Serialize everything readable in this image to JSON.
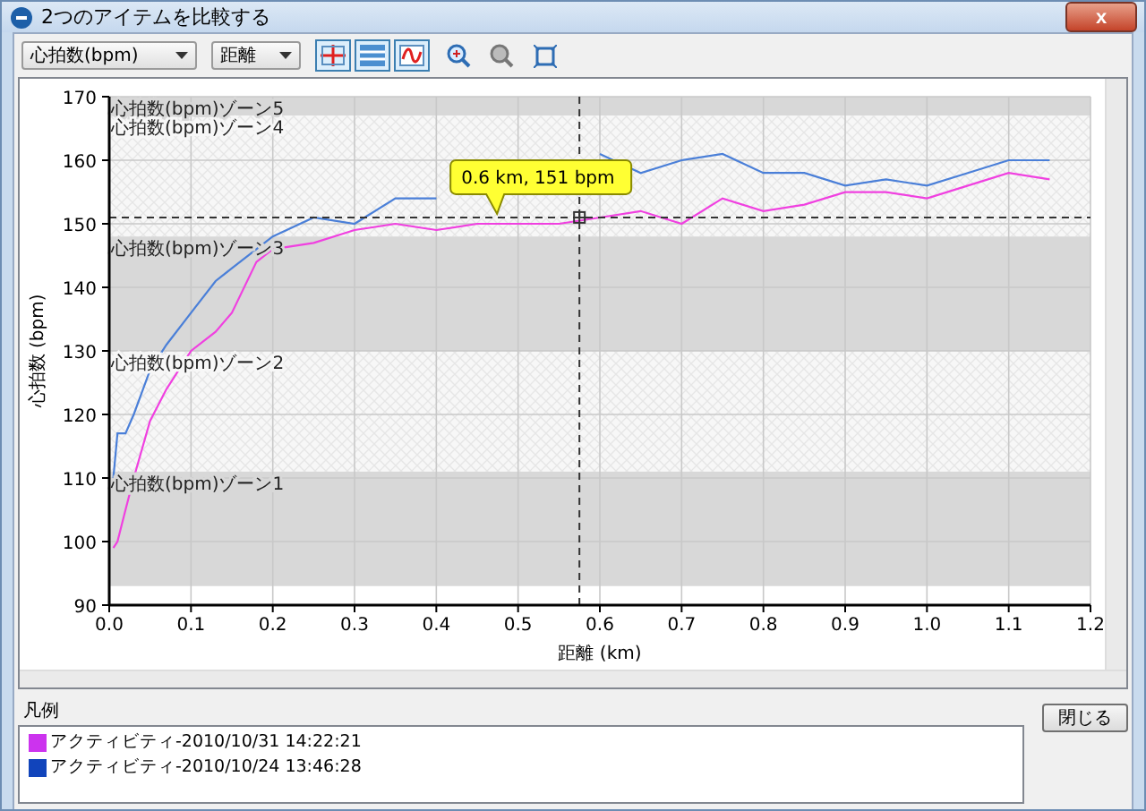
{
  "window": {
    "title": "2つのアイテムを比較する",
    "close": "x"
  },
  "toolbar": {
    "metric": "心拍数(bpm)",
    "axis": "距離"
  },
  "chart": {
    "chart_data": {
      "type": "line",
      "xlabel": "距離 (km)",
      "ylabel": "心拍数 (bpm)",
      "xlim": [
        0,
        1.2
      ],
      "ylim": [
        90,
        170
      ],
      "grid": true,
      "xticks": [
        {
          "value": 0,
          "label": "0.0"
        },
        {
          "value": 0.1,
          "label": "0.1"
        },
        {
          "value": 0.2,
          "label": "0.2"
        },
        {
          "value": 0.3,
          "label": "0.3"
        },
        {
          "value": 0.4,
          "label": "0.4"
        },
        {
          "value": 0.5,
          "label": "0.5"
        },
        {
          "value": 0.6,
          "label": "0.6"
        },
        {
          "value": 0.7,
          "label": "0.7"
        },
        {
          "value": 0.8,
          "label": "0.8"
        },
        {
          "value": 0.9,
          "label": "0.9"
        },
        {
          "value": 1.0,
          "label": "1.0"
        },
        {
          "value": 1.1,
          "label": "1.1"
        },
        {
          "value": 1.2,
          "label": "1.2"
        }
      ],
      "yticks": [
        90,
        100,
        110,
        120,
        130,
        140,
        150,
        160,
        170
      ],
      "bands": [
        {
          "label": "心拍数(bpm)ゾーン5",
          "axis": "y",
          "from": 167,
          "to": 170,
          "color": "#d8d8d8"
        },
        {
          "label": "心拍数(bpm)ゾーン4",
          "axis": "y",
          "from": 148,
          "to": 167,
          "color": "#f7f7f7"
        },
        {
          "label": "心拍数(bpm)ゾーン3",
          "axis": "y",
          "from": 130,
          "to": 148,
          "color": "#d8d8d8"
        },
        {
          "label": "心拍数(bpm)ゾーン2",
          "axis": "y",
          "from": 111,
          "to": 130,
          "color": "#f7f7f7"
        },
        {
          "label": "心拍数(bpm)ゾーン1",
          "axis": "y",
          "from": 93,
          "to": 111,
          "color": "#d8d8d8"
        }
      ],
      "ref_lines": [
        {
          "axis": "x",
          "value": 0.575
        },
        {
          "axis": "y",
          "value": 151
        }
      ],
      "annotations": [
        {
          "x": 0.575,
          "y": 151,
          "text": "0.6 km, 151 bpm"
        }
      ],
      "x": [
        0.005,
        0.01,
        0.02,
        0.03,
        0.05,
        0.07,
        0.1,
        0.13,
        0.15,
        0.18,
        0.2,
        0.25,
        0.3,
        0.35,
        0.4,
        0.45,
        0.5,
        0.55,
        0.6,
        0.65,
        0.7,
        0.75,
        0.8,
        0.85,
        0.9,
        0.95,
        1.0,
        1.05,
        1.1,
        1.15
      ],
      "series": [
        {
          "name": "アクティビティ-2010/10/31 14:22:21",
          "color": "#f040e0",
          "values": [
            99,
            100,
            105,
            110,
            119,
            124,
            130,
            133,
            136,
            144,
            146,
            147,
            149,
            150,
            149,
            150,
            150,
            150,
            151,
            152,
            150,
            154,
            152,
            153,
            155,
            155,
            154,
            156,
            158,
            157
          ]
        },
        {
          "name": "アクティビティ-2010/10/24 13:46:28",
          "color": "#4a7fd8",
          "values": [
            110,
            117,
            117,
            120,
            127,
            131,
            136,
            141,
            143,
            146,
            148,
            151,
            150,
            154,
            154,
            null,
            null,
            null,
            161,
            158,
            160,
            161,
            158,
            158,
            156,
            157,
            156,
            158,
            160,
            160
          ]
        }
      ]
    }
  },
  "legend": {
    "title": "凡例",
    "items": [
      {
        "color": "#cc33ee"
      },
      {
        "color": "#1144bb"
      }
    ]
  },
  "close_button": "閉じる"
}
